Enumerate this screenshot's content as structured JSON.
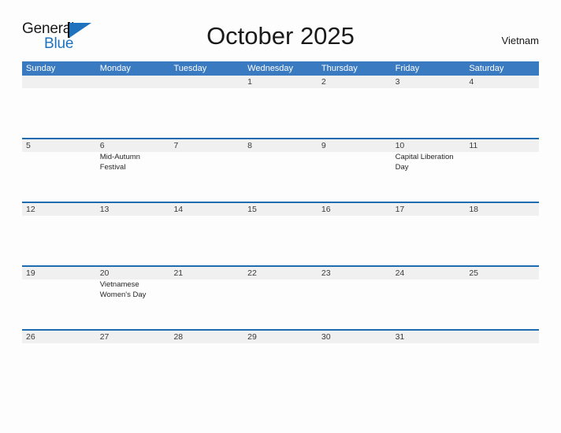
{
  "brand": {
    "name_part1": "General",
    "name_part2": "Blue",
    "triangle_icon": "triangle-icon",
    "accent_color": "#1f72bd"
  },
  "header": {
    "title": "October 2025",
    "country": "Vietnam"
  },
  "colors": {
    "header_band": "#3a7ac0",
    "week_rule": "#1f6cb0",
    "date_band": "#f0f0f0",
    "page_background": "#fdfdfd"
  },
  "calendar": {
    "month": "October",
    "year": "2025",
    "weekday_headers": [
      "Sunday",
      "Monday",
      "Tuesday",
      "Wednesday",
      "Thursday",
      "Friday",
      "Saturday"
    ],
    "weeks": [
      {
        "days": [
          {
            "date": "",
            "events": []
          },
          {
            "date": "",
            "events": []
          },
          {
            "date": "",
            "events": []
          },
          {
            "date": "1",
            "events": []
          },
          {
            "date": "2",
            "events": []
          },
          {
            "date": "3",
            "events": []
          },
          {
            "date": "4",
            "events": []
          }
        ]
      },
      {
        "days": [
          {
            "date": "5",
            "events": []
          },
          {
            "date": "6",
            "events": [
              "Mid-Autumn Festival"
            ]
          },
          {
            "date": "7",
            "events": []
          },
          {
            "date": "8",
            "events": []
          },
          {
            "date": "9",
            "events": []
          },
          {
            "date": "10",
            "events": [
              "Capital Liberation Day"
            ]
          },
          {
            "date": "11",
            "events": []
          }
        ]
      },
      {
        "days": [
          {
            "date": "12",
            "events": []
          },
          {
            "date": "13",
            "events": []
          },
          {
            "date": "14",
            "events": []
          },
          {
            "date": "15",
            "events": []
          },
          {
            "date": "16",
            "events": []
          },
          {
            "date": "17",
            "events": []
          },
          {
            "date": "18",
            "events": []
          }
        ]
      },
      {
        "days": [
          {
            "date": "19",
            "events": []
          },
          {
            "date": "20",
            "events": [
              "Vietnamese Women's Day"
            ]
          },
          {
            "date": "21",
            "events": []
          },
          {
            "date": "22",
            "events": []
          },
          {
            "date": "23",
            "events": []
          },
          {
            "date": "24",
            "events": []
          },
          {
            "date": "25",
            "events": []
          }
        ]
      },
      {
        "days": [
          {
            "date": "26",
            "events": []
          },
          {
            "date": "27",
            "events": []
          },
          {
            "date": "28",
            "events": []
          },
          {
            "date": "29",
            "events": []
          },
          {
            "date": "30",
            "events": []
          },
          {
            "date": "31",
            "events": []
          },
          {
            "date": "",
            "events": []
          }
        ]
      }
    ]
  }
}
